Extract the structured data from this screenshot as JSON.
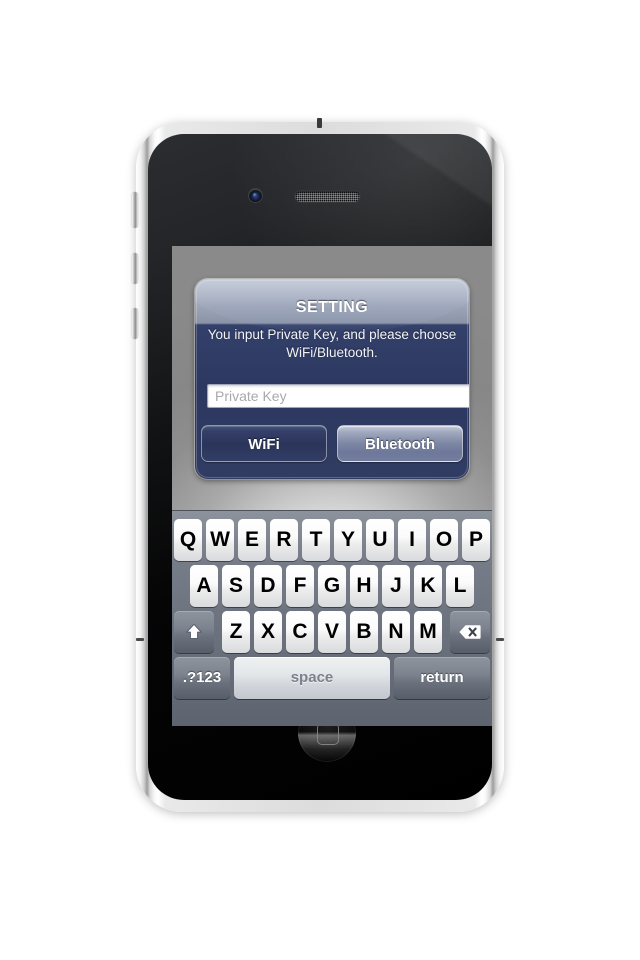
{
  "device": {
    "name": "smartphone-mockup",
    "hardware": {
      "front_camera": "camera-icon",
      "earpiece": "speaker-grille-icon",
      "home_button": "home-button-icon",
      "silent_switch": "silent-switch",
      "volume_up": "volume-up-button",
      "volume_down": "volume-down-button"
    }
  },
  "dialog": {
    "title": "SETTING",
    "message": "You input Private Key, and please choose WiFi/Bluetooth.",
    "input": {
      "value": "",
      "placeholder": "Private Key"
    },
    "buttons": [
      {
        "label": "WiFi",
        "color": "#2b355b",
        "selected": false
      },
      {
        "label": "Bluetooth",
        "color": "#7d87a3",
        "selected": true
      }
    ]
  },
  "keyboard": {
    "layout": "qwerty-uppercase",
    "row1": [
      "Q",
      "W",
      "E",
      "R",
      "T",
      "Y",
      "U",
      "I",
      "O",
      "P"
    ],
    "row2": [
      "A",
      "S",
      "D",
      "F",
      "G",
      "H",
      "J",
      "K",
      "L"
    ],
    "row3": [
      "Z",
      "X",
      "C",
      "V",
      "B",
      "N",
      "M"
    ],
    "shift_key": "shift-icon",
    "backspace_key": "backspace-icon",
    "numeric_key": ".?123",
    "space_key": "space",
    "return_key": "return"
  },
  "colors": {
    "app_background": "#8a8a8a",
    "dialog_body": "#2c3860",
    "keyboard_background": "#6b727e",
    "key_light": "#ffffff",
    "key_dark": "#6a717c"
  }
}
